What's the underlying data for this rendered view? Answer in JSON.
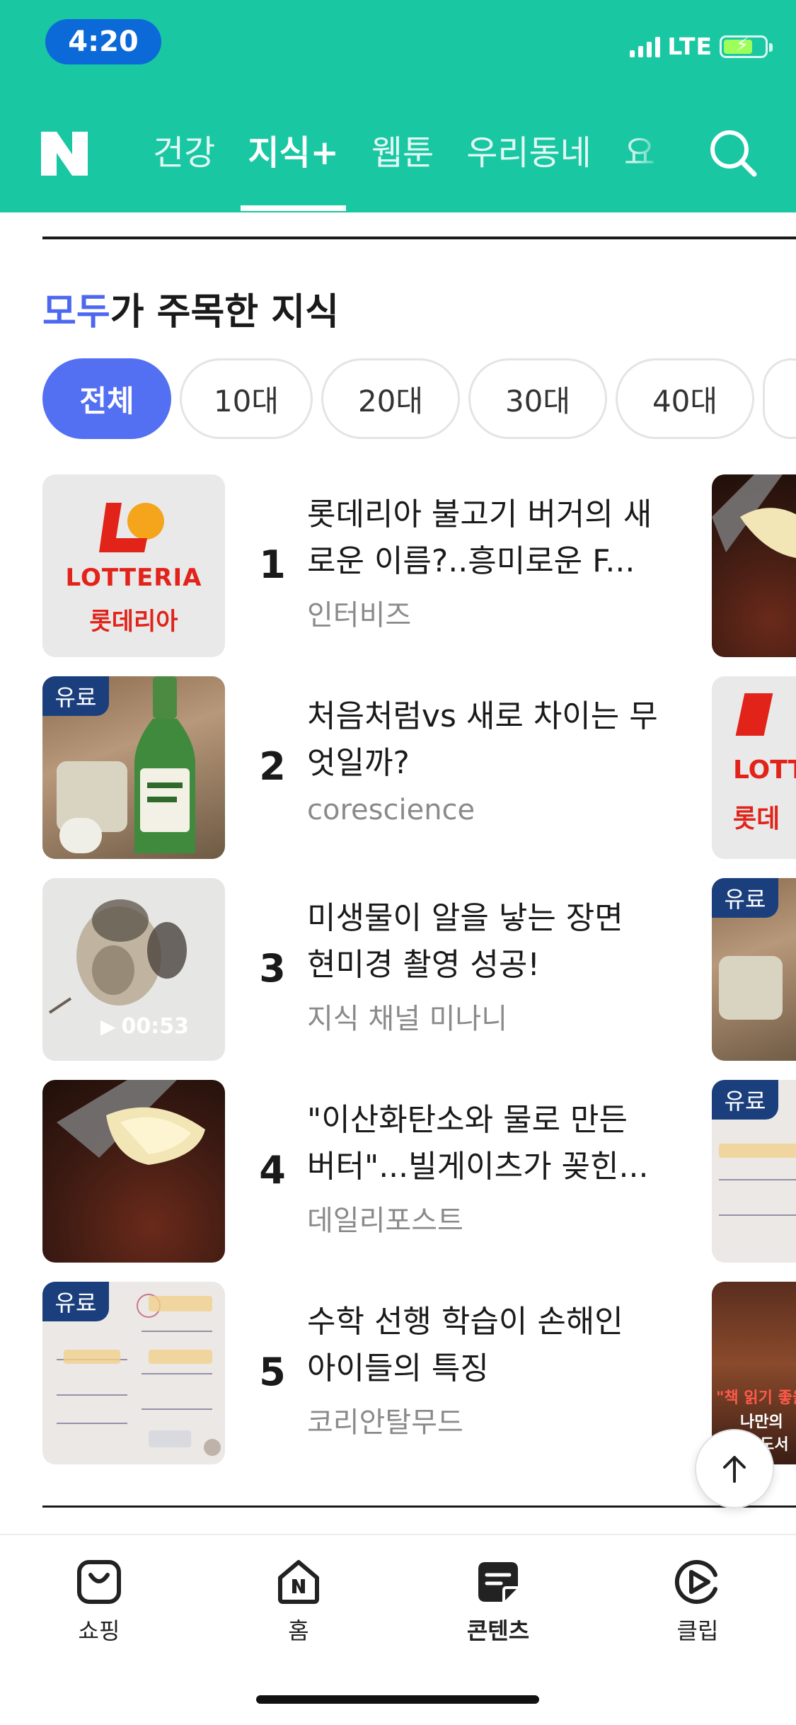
{
  "status_bar": {
    "time": "4:20",
    "network": "LTE"
  },
  "header": {
    "logo": "N",
    "tabs": [
      {
        "label": "건강"
      },
      {
        "label": "지식+"
      },
      {
        "label": "웹툰"
      },
      {
        "label": "우리동네"
      },
      {
        "label": "요"
      }
    ],
    "active_tab": "지식+"
  },
  "section": {
    "title_highlight": "모두",
    "title_rest": "가 주목한 지식",
    "filters": [
      "전체",
      "10대",
      "20대",
      "30대",
      "40대"
    ],
    "active_filter": "전체"
  },
  "items": [
    {
      "rank": "1",
      "title": "롯데리아 불고기 버거의 새로운 이름?..흥미로운 F...",
      "source": "인터비즈",
      "paid": false,
      "thumb": "lotteria-logo",
      "logo_text_en": "LOTTERIA",
      "logo_text_ko": "롯데리아"
    },
    {
      "rank": "2",
      "title": "처음처럼vs 새로 차이는 무엇일까?",
      "source": "corescience",
      "paid": true,
      "paid_label": "유료",
      "thumb": "soju-bottle"
    },
    {
      "rank": "3",
      "title": "미생물이 알을 낳는 장면 현미경 촬영 성공!",
      "source": "지식 채널 미나니",
      "paid": false,
      "thumb": "microscope-video",
      "duration": "00:53"
    },
    {
      "rank": "4",
      "title": "\"이산화탄소와 물로 만든 버터\"...빌게이츠가 꽂힌...",
      "source": "데일리포스트",
      "paid": false,
      "thumb": "butter-on-steak"
    },
    {
      "rank": "5",
      "title": "수학 선행 학습이 손해인 아이들의 특징",
      "source": "코리안탈무드",
      "paid": true,
      "paid_label": "유료",
      "thumb": "math-worksheet"
    }
  ],
  "peek_column": [
    {
      "thumb": "butter-on-steak",
      "paid": false
    },
    {
      "thumb": "lotteria-logo",
      "paid": false,
      "logo_text": "LOTT",
      "logo_text_ko": "롯데"
    },
    {
      "thumb": "soju-table",
      "paid": true,
      "paid_label": "유료"
    },
    {
      "thumb": "math-worksheet",
      "paid": true,
      "paid_label": "유료"
    },
    {
      "thumb": "bookshelf",
      "paid": false,
      "caption_1": "\"책 읽기 좋을",
      "caption_2": "나만의",
      "caption_3": "서울 도서"
    }
  ],
  "bottom_nav": [
    {
      "label": "쇼핑",
      "icon": "shopping-bag-icon"
    },
    {
      "label": "홈",
      "icon": "home-icon"
    },
    {
      "label": "콘텐츠",
      "icon": "content-icon"
    },
    {
      "label": "클립",
      "icon": "clip-play-icon"
    }
  ],
  "active_bottom_nav": "콘텐츠",
  "colors": {
    "header_bg": "#19c7a3",
    "accent": "#5470f2",
    "paid_badge": "#1b3f7d",
    "time_pill": "#0b69d8"
  }
}
